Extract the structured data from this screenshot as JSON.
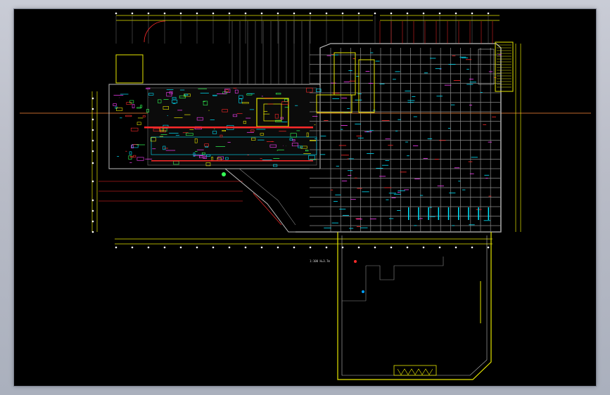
{
  "window": {
    "background": "#b9bcc7",
    "viewport_background": "#000000"
  },
  "drawing": {
    "type": "architectural-floor-plan",
    "layer_colors": {
      "walls": "#bdbdbd",
      "grid": "#8c8c8c",
      "dimension": "#ffff00",
      "annotation_red": "#ff2a2a",
      "annotation_cyan": "#00e5ff",
      "annotation_green": "#33ff55",
      "annotation_magenta": "#ff40ff",
      "reference_line": "#ff8a3d",
      "yellow_outline": "#e6e600"
    },
    "scale_note": "1:100  H=3.7m"
  }
}
